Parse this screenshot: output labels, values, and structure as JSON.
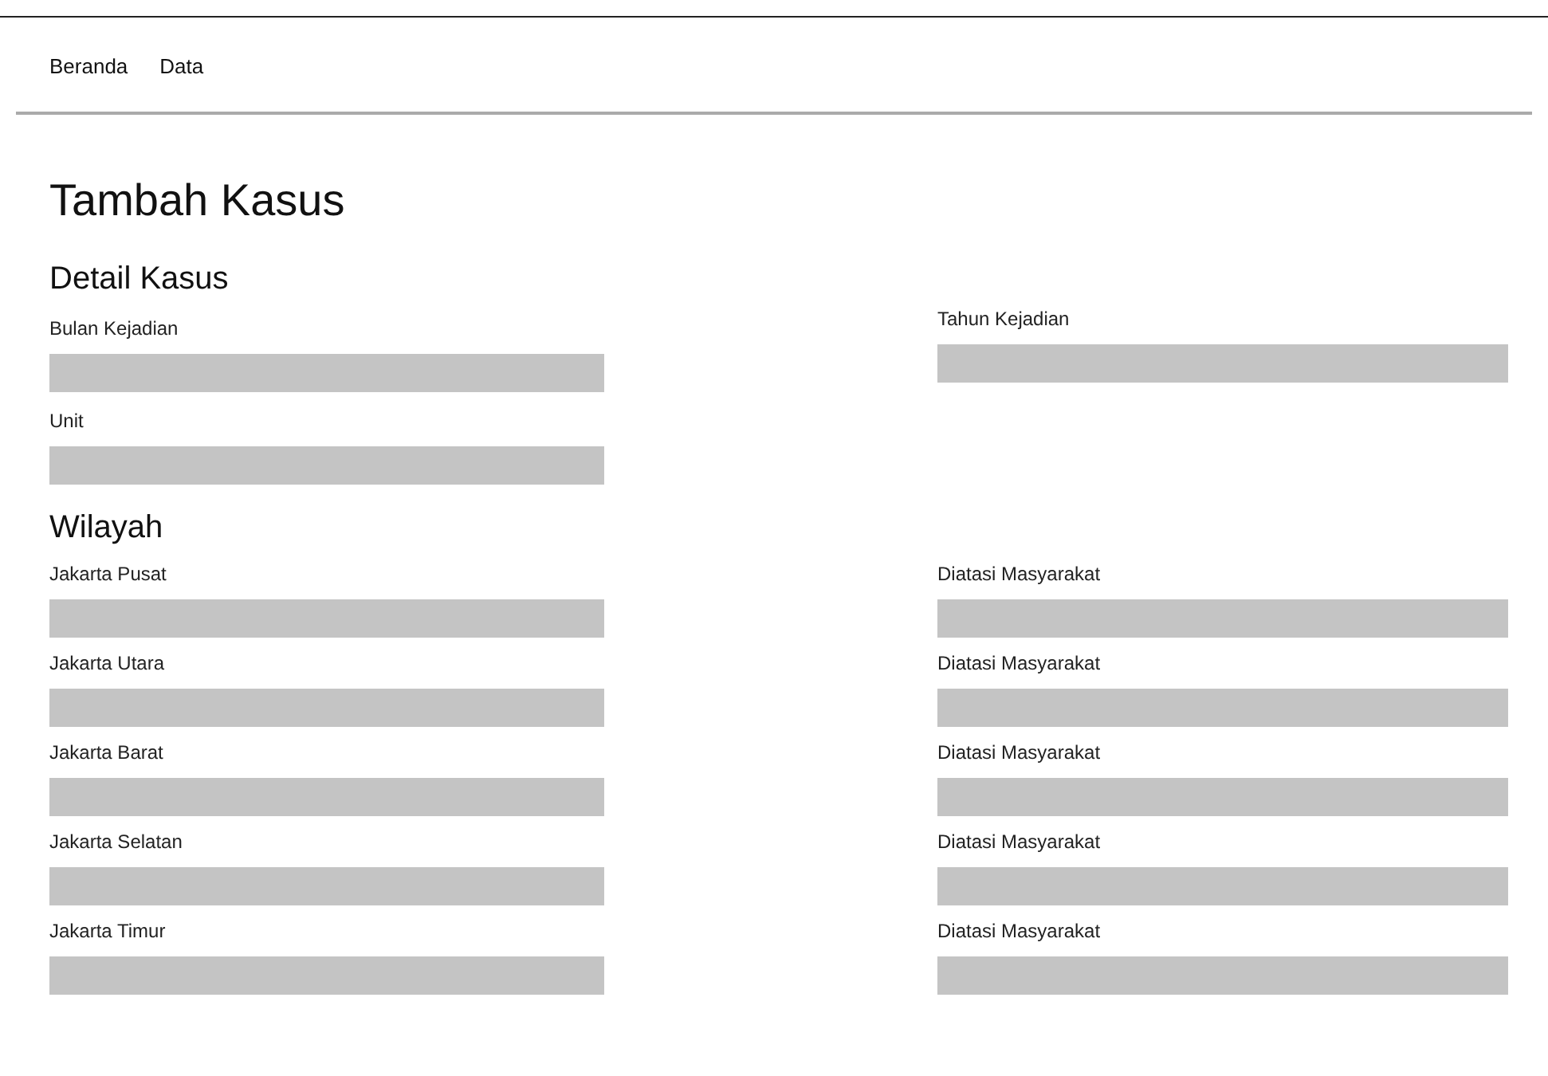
{
  "nav": {
    "items": [
      {
        "label": "Beranda"
      },
      {
        "label": "Data"
      }
    ]
  },
  "page_title": "Tambah Kasus",
  "detail_section": {
    "heading": "Detail Kasus",
    "left_fields": [
      {
        "label": "Bulan Kejadian"
      },
      {
        "label": "Unit"
      }
    ],
    "right_fields": [
      {
        "label": "Tahun Kejadian"
      }
    ]
  },
  "region_section": {
    "heading": "Wilayah",
    "rows": [
      {
        "region_label": "Jakarta Pusat",
        "community_label": "Diatasi Masyarakat"
      },
      {
        "region_label": "Jakarta Utara",
        "community_label": "Diatasi Masyarakat"
      },
      {
        "region_label": "Jakarta Barat",
        "community_label": "Diatasi Masyarakat"
      },
      {
        "region_label": "Jakarta Selatan",
        "community_label": "Diatasi Masyarakat"
      },
      {
        "region_label": "Jakarta Timur",
        "community_label": "Diatasi Masyarakat"
      }
    ]
  }
}
